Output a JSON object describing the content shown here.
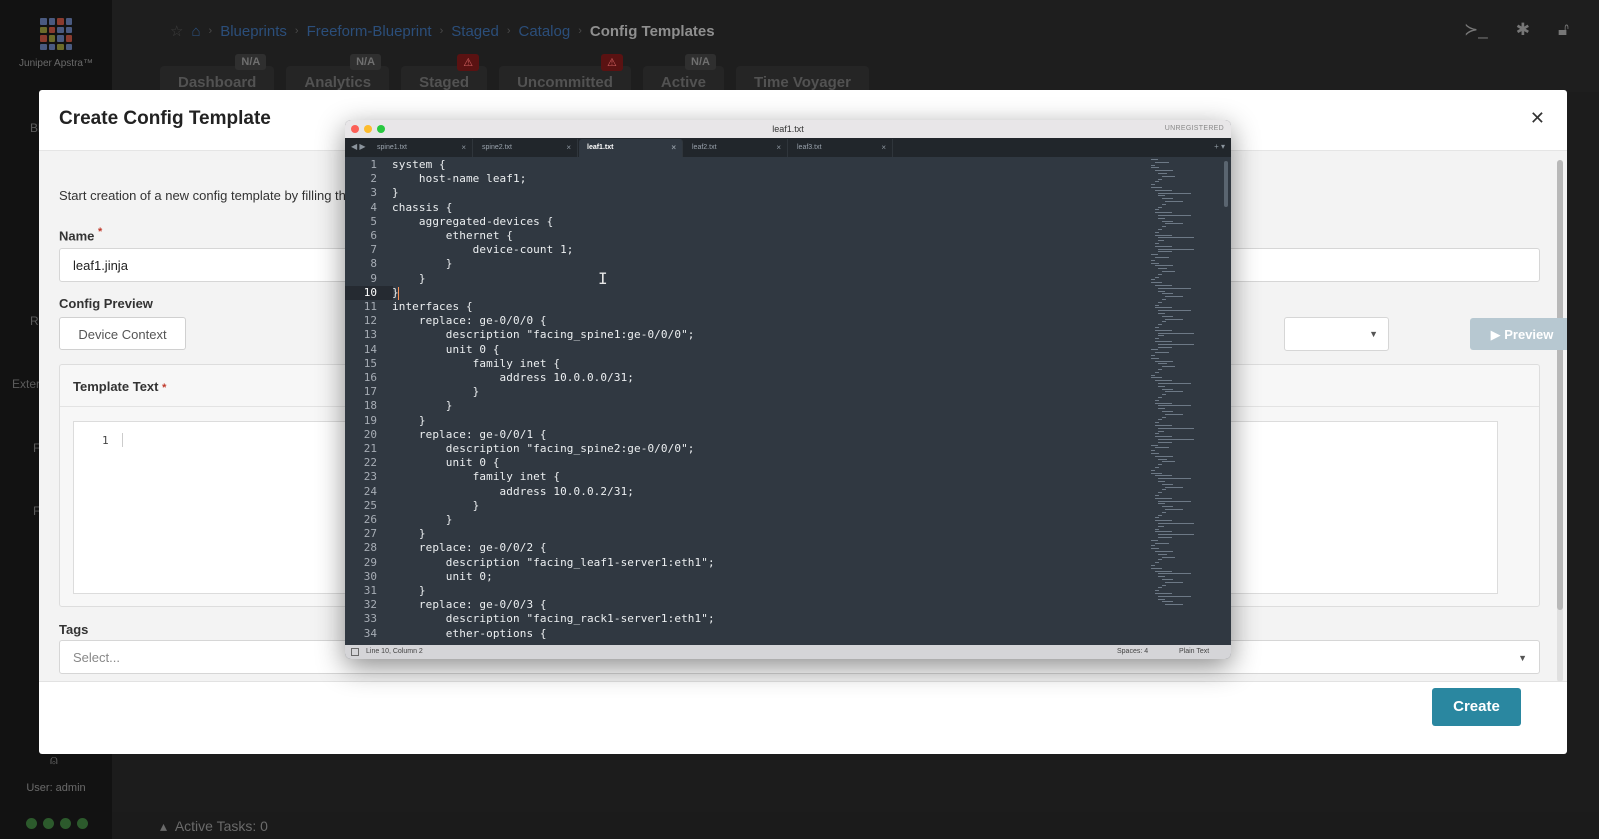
{
  "app": {
    "brand": "Juniper Apstra™",
    "user_label": "User: admin",
    "sidebar_fragments": [
      "Bl",
      "R",
      "Exter",
      "F",
      "F"
    ],
    "active_tasks": "Active Tasks: 0"
  },
  "breadcrumb": {
    "items": [
      "Blueprints",
      "Freeform-Blueprint",
      "Staged",
      "Catalog"
    ],
    "current": "Config Templates"
  },
  "top_icons": [
    "terminal-icon",
    "bug-icon",
    "lock-icon"
  ],
  "main_tabs": [
    {
      "label": "Dashboard",
      "badge": "N/A",
      "badge_type": "na"
    },
    {
      "label": "Analytics",
      "badge": "N/A",
      "badge_type": "na"
    },
    {
      "label": "Staged",
      "badge": "⚠",
      "badge_type": "alert"
    },
    {
      "label": "Uncommitted",
      "badge": "⚠",
      "badge_type": "alert"
    },
    {
      "label": "Active",
      "badge": "N/A",
      "badge_type": "na"
    },
    {
      "label": "Time Voyager",
      "badge": "",
      "badge_type": ""
    }
  ],
  "modal": {
    "title": "Create Config Template",
    "intro": "Start creation of a new config template by filling th",
    "name_label": "Name",
    "name_value": "leaf1.jinja",
    "config_preview_label": "Config Preview",
    "device_context_button": "Device Context",
    "preview_button": "Preview",
    "template_text_label": "Template Text",
    "template_line_number": "1",
    "tags_label": "Tags",
    "tags_placeholder": "Select...",
    "create_button": "Create",
    "required_mark": "*"
  },
  "editor": {
    "window_title": "leaf1.txt",
    "unregistered": "UNREGISTERED",
    "tabs": [
      {
        "label": "spine1.txt",
        "active": false
      },
      {
        "label": "spine2.txt",
        "active": false
      },
      {
        "label": "leaf1.txt",
        "active": true
      },
      {
        "label": "leaf2.txt",
        "active": false
      },
      {
        "label": "leaf3.txt",
        "active": false
      }
    ],
    "current_line": 10,
    "lines": [
      "system {",
      "    host-name leaf1;",
      "}",
      "chassis {",
      "    aggregated-devices {",
      "        ethernet {",
      "            device-count 1;",
      "        }",
      "    }",
      "}",
      "interfaces {",
      "    replace: ge-0/0/0 {",
      "        description \"facing_spine1:ge-0/0/0\";",
      "        unit 0 {",
      "            family inet {",
      "                address 10.0.0.0/31;",
      "            }",
      "        }",
      "    }",
      "    replace: ge-0/0/1 {",
      "        description \"facing_spine2:ge-0/0/0\";",
      "        unit 0 {",
      "            family inet {",
      "                address 10.0.0.2/31;",
      "            }",
      "        }",
      "    }",
      "    replace: ge-0/0/2 {",
      "        description \"facing_leaf1-server1:eth1\";",
      "        unit 0;",
      "    }",
      "    replace: ge-0/0/3 {",
      "        description \"facing_rack1-server1:eth1\";",
      "        ether-options {"
    ],
    "status_position": "Line 10, Column 2",
    "status_spaces": "Spaces: 4",
    "status_syntax": "Plain Text"
  }
}
